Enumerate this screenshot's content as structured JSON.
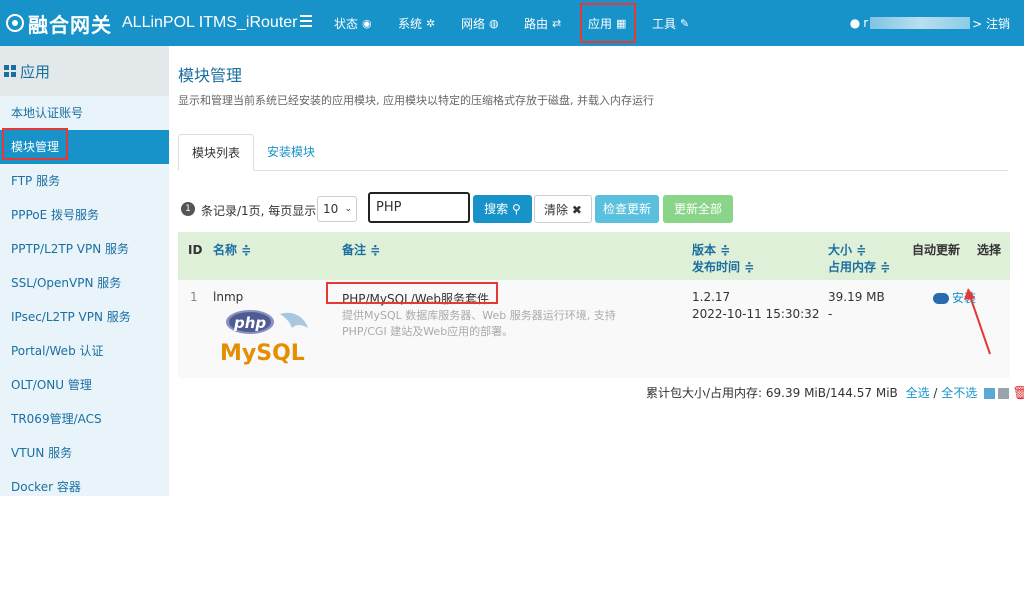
{
  "topbar": {
    "brand_cn": "融合网关",
    "brand_en": "ALLinPOL ITMS_iRouter",
    "nav": [
      {
        "label": "状态",
        "icon": "eye-icon",
        "glyph": "◉"
      },
      {
        "label": "系统",
        "icon": "gear-icon",
        "glyph": "✲"
      },
      {
        "label": "网络",
        "icon": "globe-icon",
        "glyph": "◍"
      },
      {
        "label": "路由",
        "icon": "shuffle-icon",
        "glyph": "⇄"
      },
      {
        "label": "应用",
        "icon": "grid-icon",
        "glyph": "▦"
      },
      {
        "label": "工具",
        "icon": "wrench-icon",
        "glyph": "✎"
      }
    ],
    "user_prefix": "r",
    "user_suffix": "> 注销"
  },
  "sidebar": {
    "header": "应用",
    "items": [
      {
        "label": "本地认证账号"
      },
      {
        "label": "模块管理"
      },
      {
        "label": "FTP 服务"
      },
      {
        "label": "PPPoE 拨号服务"
      },
      {
        "label": "PPTP/L2TP VPN 服务"
      },
      {
        "label": "SSL/OpenVPN 服务"
      },
      {
        "label": "IPsec/L2TP VPN 服务"
      },
      {
        "label": "Portal/Web 认证"
      },
      {
        "label": "OLT/ONU 管理"
      },
      {
        "label": "TR069管理/ACS"
      },
      {
        "label": "VTUN 服务"
      },
      {
        "label": "Docker 容器"
      }
    ]
  },
  "main": {
    "title": "模块管理",
    "description": "显示和管理当前系统已经安装的应用模块, 应用模块以特定的压缩格式存放于磁盘, 并载入内存运行",
    "tabs": [
      {
        "label": "模块列表"
      },
      {
        "label": "安装模块"
      }
    ],
    "toolbar": {
      "badge": "1",
      "count_text": "条记录/1页, 每页显示",
      "page_size": "10",
      "search_value": "PHP",
      "search_label": "搜索",
      "clear_label": "清除",
      "check_update_label": "检查更新",
      "update_all_label": "更新全部"
    },
    "table": {
      "headers": {
        "id": "ID",
        "name": "名称 ≑",
        "remark": "备注 ≑",
        "version": "版本 ≑",
        "release_time": "发布时间 ≑",
        "size": "大小 ≑",
        "mem": "占用内存 ≑",
        "auto_update": "自动更新",
        "select": "选择"
      },
      "rows": [
        {
          "id": "1",
          "name": "lnmp",
          "remark_title": "PHP/MySQL/Web服务套件",
          "remark_desc1": "提供MySQL 数据库服务器、Web 服务器运行环境, 支持",
          "remark_desc2": "PHP/CGI 建站及Web应用的部署。",
          "version": "1.2.17",
          "release_time": "2022-10-11 15:30:32",
          "size": "39.19 MB",
          "mem": "-",
          "action": "安装",
          "logo_php": "php",
          "logo_mysql": "MySQL"
        }
      ]
    },
    "summary": {
      "text": "累计包大小/占用内存: 69.39 MiB/144.57 MiB",
      "select_all": "全选",
      "separator": " / ",
      "select_none": "全不选"
    }
  },
  "colors": {
    "topbar": "#1793c9",
    "highlight": "#e53935",
    "header_row": "#dff0d8"
  }
}
